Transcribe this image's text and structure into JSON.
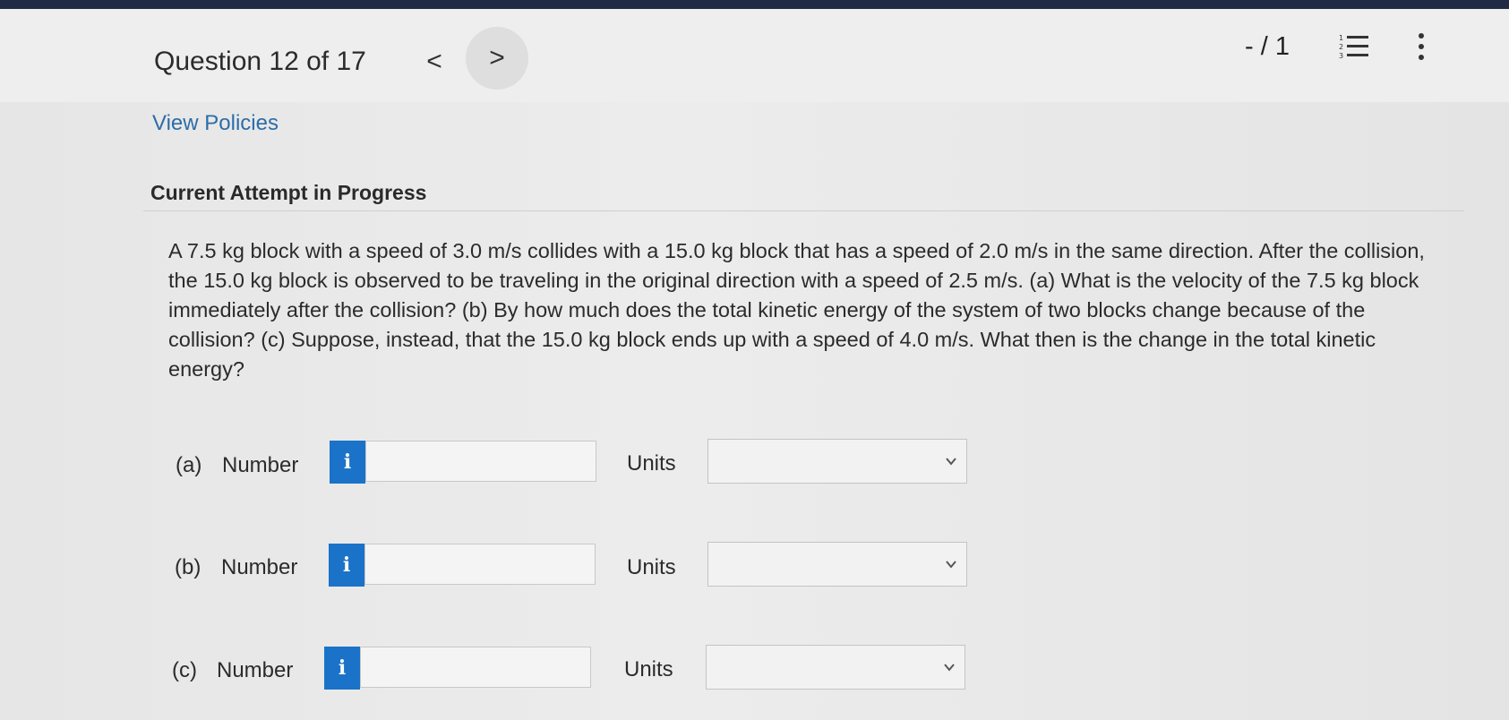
{
  "header": {
    "question_counter": "Question 12 of 17",
    "prev_label": "<",
    "next_label": ">",
    "score": "- / 1"
  },
  "links": {
    "view_policies": "View Policies"
  },
  "attempt_heading": "Current Attempt in Progress",
  "question_text": "A 7.5 kg block with a speed of 3.0 m/s collides with a 15.0 kg block that has a speed of 2.0 m/s in the same direction. After the collision, the 15.0 kg block is observed to be traveling in the original direction with a speed of 2.5 m/s. (a) What is the velocity of the 7.5 kg block immediately after the collision? (b) By how much does the total kinetic energy of the system of two blocks change because of the collision? (c) Suppose, instead, that the 15.0 kg block ends up with a speed of 4.0 m/s. What then is the change in the total kinetic energy?",
  "parts": [
    {
      "label": "(a)",
      "number_label": "Number",
      "info": "i",
      "value": "",
      "units_label": "Units",
      "units_value": ""
    },
    {
      "label": "(b)",
      "number_label": "Number",
      "info": "i",
      "value": "",
      "units_label": "Units",
      "units_value": ""
    },
    {
      "label": "(c)",
      "number_label": "Number",
      "info": "i",
      "value": "",
      "units_label": "Units",
      "units_value": ""
    }
  ],
  "colors": {
    "info_button": "#1a73c8",
    "link": "#2c6da8",
    "top_bar": "#1f2a44"
  },
  "icons": {
    "list": "numbered-list-icon",
    "more": "more-vertical-icon",
    "chevron": "chevron-down-icon"
  }
}
